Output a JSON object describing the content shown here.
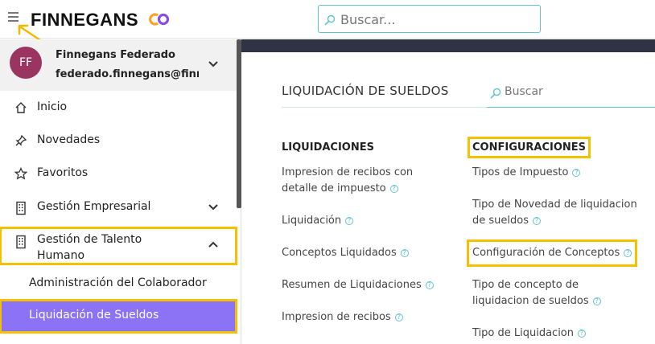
{
  "header": {
    "logo_text": "FINNEGANS",
    "search_placeholder": "Buscar..."
  },
  "user": {
    "initials": "FF",
    "name": "Finnegans Federado",
    "email": "federado.finnegans@finn..."
  },
  "sidebar": {
    "items": [
      {
        "label": "Inicio",
        "icon": "home-icon"
      },
      {
        "label": "Novedades",
        "icon": "pin-icon"
      },
      {
        "label": "Favoritos",
        "icon": "star-icon"
      },
      {
        "label": "Gestión Empresarial",
        "icon": "building-icon",
        "expanded": false
      },
      {
        "label": "Gestión de Talento Humano",
        "icon": "building-icon",
        "expanded": true
      }
    ],
    "sub_items": [
      {
        "label": "Administración del Colaborador",
        "active": false
      },
      {
        "label": "Liquidación de Sueldos",
        "active": true
      }
    ]
  },
  "main": {
    "title": "LIQUIDACIÓN DE SUELDOS",
    "search_placeholder": "Buscar",
    "columns": [
      {
        "heading": "LIQUIDACIONES",
        "links": [
          "Impresion de recibos con detalle de impuesto",
          "Liquidación",
          "Conceptos Liquidados",
          "Resumen de Liquidaciones",
          "Impresion de recibos"
        ]
      },
      {
        "heading": "CONFIGURACIONES",
        "links": [
          "Tipos de Impuesto",
          "Tipo de Novedad de liquidacion de sueldos",
          "Configuración de Conceptos",
          "Tipo de concepto de liquidacion de sueldos",
          "Tipo de Liquidacion"
        ]
      }
    ]
  },
  "colors": {
    "accent_teal": "#5fc4cf",
    "active_purple": "#8a73f5",
    "avatar": "#9a3562",
    "highlight": "#f5c000",
    "dark_band": "#2f3444"
  }
}
